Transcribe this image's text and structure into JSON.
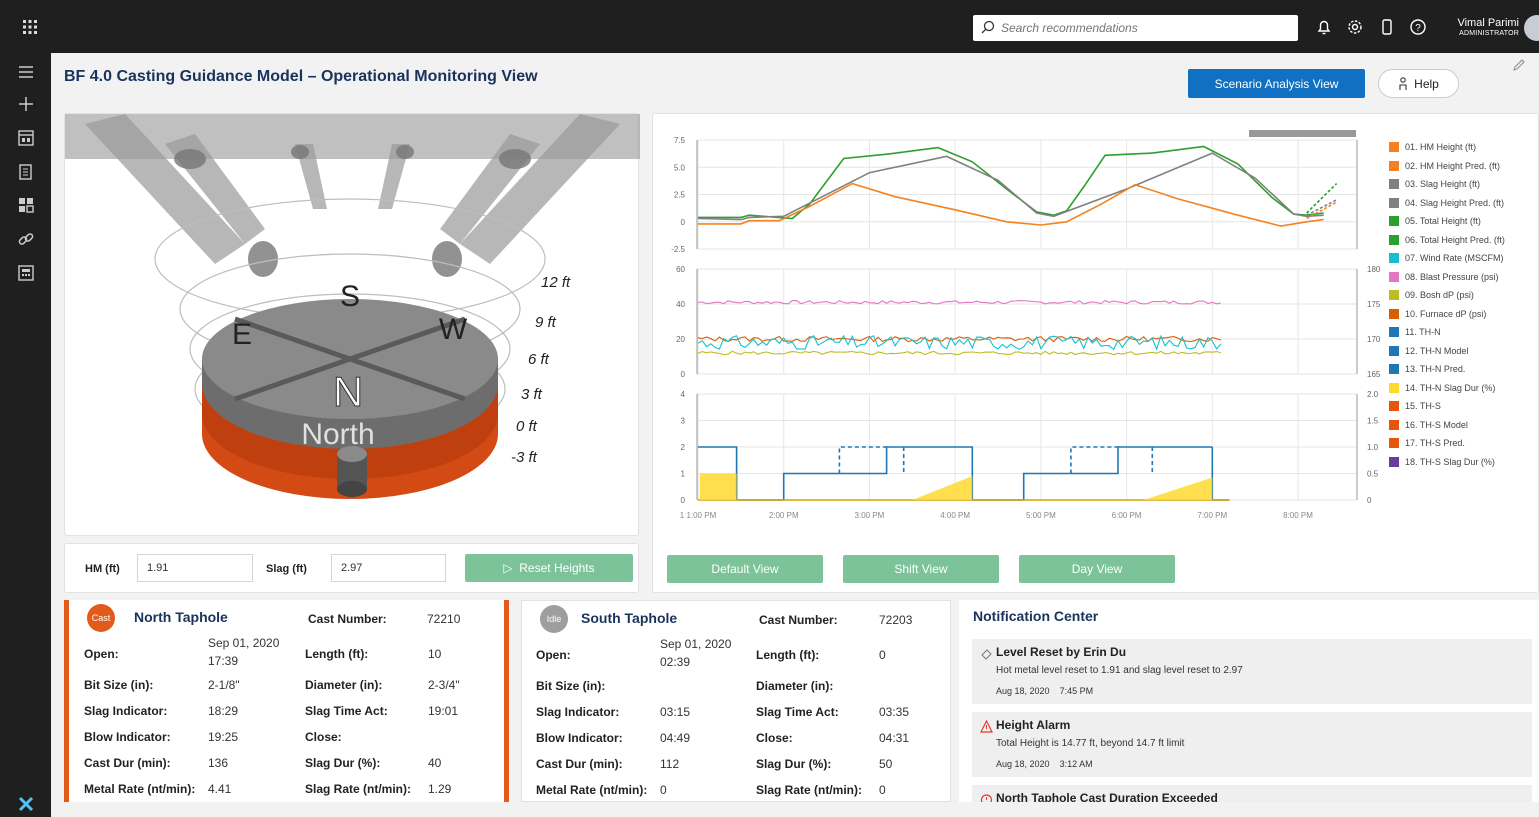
{
  "topbar": {
    "search_placeholder": "Search recommendations",
    "user_name": "Vimal Parimi",
    "user_role": "ADMINISTRATOR"
  },
  "page": {
    "title": "BF 4.0 Casting Guidance Model – Operational Monitoring View",
    "scenario_button": "Scenario Analysis View",
    "help_button": "Help"
  },
  "furnace": {
    "compass": {
      "s": "S",
      "e": "E",
      "w": "W",
      "n": "N"
    },
    "north_label": "North",
    "height_labels": [
      "12 ft",
      "9 ft",
      "6 ft",
      "3 ft",
      "0 ft",
      "-3 ft"
    ]
  },
  "controls": {
    "hm_label": "HM (ft)",
    "hm_value": "1.91",
    "slag_label": "Slag (ft)",
    "slag_value": "2.97",
    "reset_button": "Reset Heights"
  },
  "view_buttons": {
    "default": "Default View",
    "shift": "Shift View",
    "day": "Day View"
  },
  "chart_data": {
    "type": "line",
    "x_ticks": [
      "1 1:00 PM",
      "2:00 PM",
      "3:00 PM",
      "4:00 PM",
      "5:00 PM",
      "6:00 PM",
      "7:00 PM",
      "8:00 PM"
    ],
    "panels": [
      {
        "name": "heights",
        "y_ticks": [
          "7.5",
          "5.0",
          "2.5",
          "0",
          "-2.5"
        ],
        "ylim": [
          -2.5,
          7.5
        ]
      },
      {
        "name": "process",
        "y_ticks_left": [
          "60",
          "40",
          "20",
          "0"
        ],
        "y_ticks_right": [
          "180",
          "175",
          "170",
          "165"
        ],
        "ylim_left": [
          0,
          60
        ],
        "ylim_right": [
          165,
          180
        ]
      },
      {
        "name": "tapholes",
        "y_ticks_left": [
          "4",
          "3",
          "2",
          "1",
          "0"
        ],
        "y_ticks_right": [
          "2.0",
          "1.5",
          "1.0",
          "0.5",
          "0"
        ],
        "ylim_left": [
          0,
          4
        ],
        "ylim_right": [
          0,
          2
        ]
      }
    ],
    "legend": [
      {
        "label": "01. HM Height (ft)",
        "color": "#f5821f"
      },
      {
        "label": "02. HM Height Pred. (ft)",
        "color": "#f5821f"
      },
      {
        "label": "03. Slag Height (ft)",
        "color": "#808080"
      },
      {
        "label": "04. Slag Height Pred. (ft)",
        "color": "#808080"
      },
      {
        "label": "05. Total Height (ft)",
        "color": "#2ca02c"
      },
      {
        "label": "06. Total Height Pred. (ft)",
        "color": "#2ca02c"
      },
      {
        "label": "07. Wind Rate (MSCFM)",
        "color": "#17becf"
      },
      {
        "label": "08. Blast Pressure (psi)",
        "color": "#e377c2"
      },
      {
        "label": "09. Bosh dP (psi)",
        "color": "#bcbd22"
      },
      {
        "label": "10. Furnace dP (psi)",
        "color": "#d95f02"
      },
      {
        "label": "11. TH-N",
        "color": "#1f77b4"
      },
      {
        "label": "12. TH-N Model",
        "color": "#1f77b4"
      },
      {
        "label": "13. TH-N Pred.",
        "color": "#1f77b4"
      },
      {
        "label": "14. TH-N Slag Dur (%)",
        "color": "#ffd92f"
      },
      {
        "label": "15. TH-S",
        "color": "#e6550d"
      },
      {
        "label": "16. TH-S Model",
        "color": "#e6550d"
      },
      {
        "label": "17. TH-S Pred.",
        "color": "#e6550d"
      },
      {
        "label": "18. TH-S Slag Dur (%)",
        "color": "#6a3d9a"
      }
    ]
  },
  "north": {
    "badge": "Cast",
    "name": "North Taphole",
    "cast_number_label": "Cast Number:",
    "cast_number": "72210",
    "open_label": "Open:",
    "open_date": "Sep 01, 2020",
    "open_time": "17:39",
    "length_label": "Length (ft):",
    "length": "10",
    "bit_label": "Bit Size (in):",
    "bit": "2-1/8\"",
    "diam_label": "Diameter (in):",
    "diam": "2-3/4\"",
    "slagind_label": "Slag Indicator:",
    "slagind": "18:29",
    "slagtime_label": "Slag Time Act:",
    "slagtime": "19:01",
    "blow_label": "Blow Indicator:",
    "blow": "19:25",
    "close_label": "Close:",
    "close": "",
    "castdur_label": "Cast Dur (min):",
    "castdur": "136",
    "slagdur_label": "Slag Dur (%):",
    "slagdur": "40",
    "metal_label": "Metal Rate (nt/min):",
    "metal": "4.41",
    "slagrate_label": "Slag Rate (nt/min):",
    "slagrate": "1.29"
  },
  "south": {
    "badge": "Idle",
    "name": "South Taphole",
    "cast_number_label": "Cast Number:",
    "cast_number": "72203",
    "open_label": "Open:",
    "open_date": "Sep 01, 2020",
    "open_time": "02:39",
    "length_label": "Length (ft):",
    "length": "0",
    "bit_label": "Bit Size (in):",
    "bit": "",
    "diam_label": "Diameter (in):",
    "diam": "",
    "slagind_label": "Slag Indicator:",
    "slagind": "03:15",
    "slagtime_label": "Slag Time Act:",
    "slagtime": "03:35",
    "blow_label": "Blow Indicator:",
    "blow": "04:49",
    "close_label": "Close:",
    "close": "04:31",
    "castdur_label": "Cast Dur (min):",
    "castdur": "112",
    "slagdur_label": "Slag Dur (%):",
    "slagdur": "50",
    "metal_label": "Metal Rate (nt/min):",
    "metal": "0",
    "slagrate_label": "Slag Rate (nt/min):",
    "slagrate": "0"
  },
  "notifications": {
    "title": "Notification Center",
    "items": [
      {
        "title": "Level Reset by Erin Du",
        "desc": "Hot metal level reset to 1.91 and slag level reset to 2.97",
        "date": "Aug 18, 2020",
        "time": "7:45 PM"
      },
      {
        "title": "Height Alarm",
        "desc": "Total Height is 14.77 ft, beyond 14.7 ft limit",
        "date": "Aug 18, 2020",
        "time": "3:12 AM"
      },
      {
        "title": "North Taphole Cast Duration Exceeded",
        "desc": "",
        "date": "",
        "time": ""
      }
    ]
  }
}
